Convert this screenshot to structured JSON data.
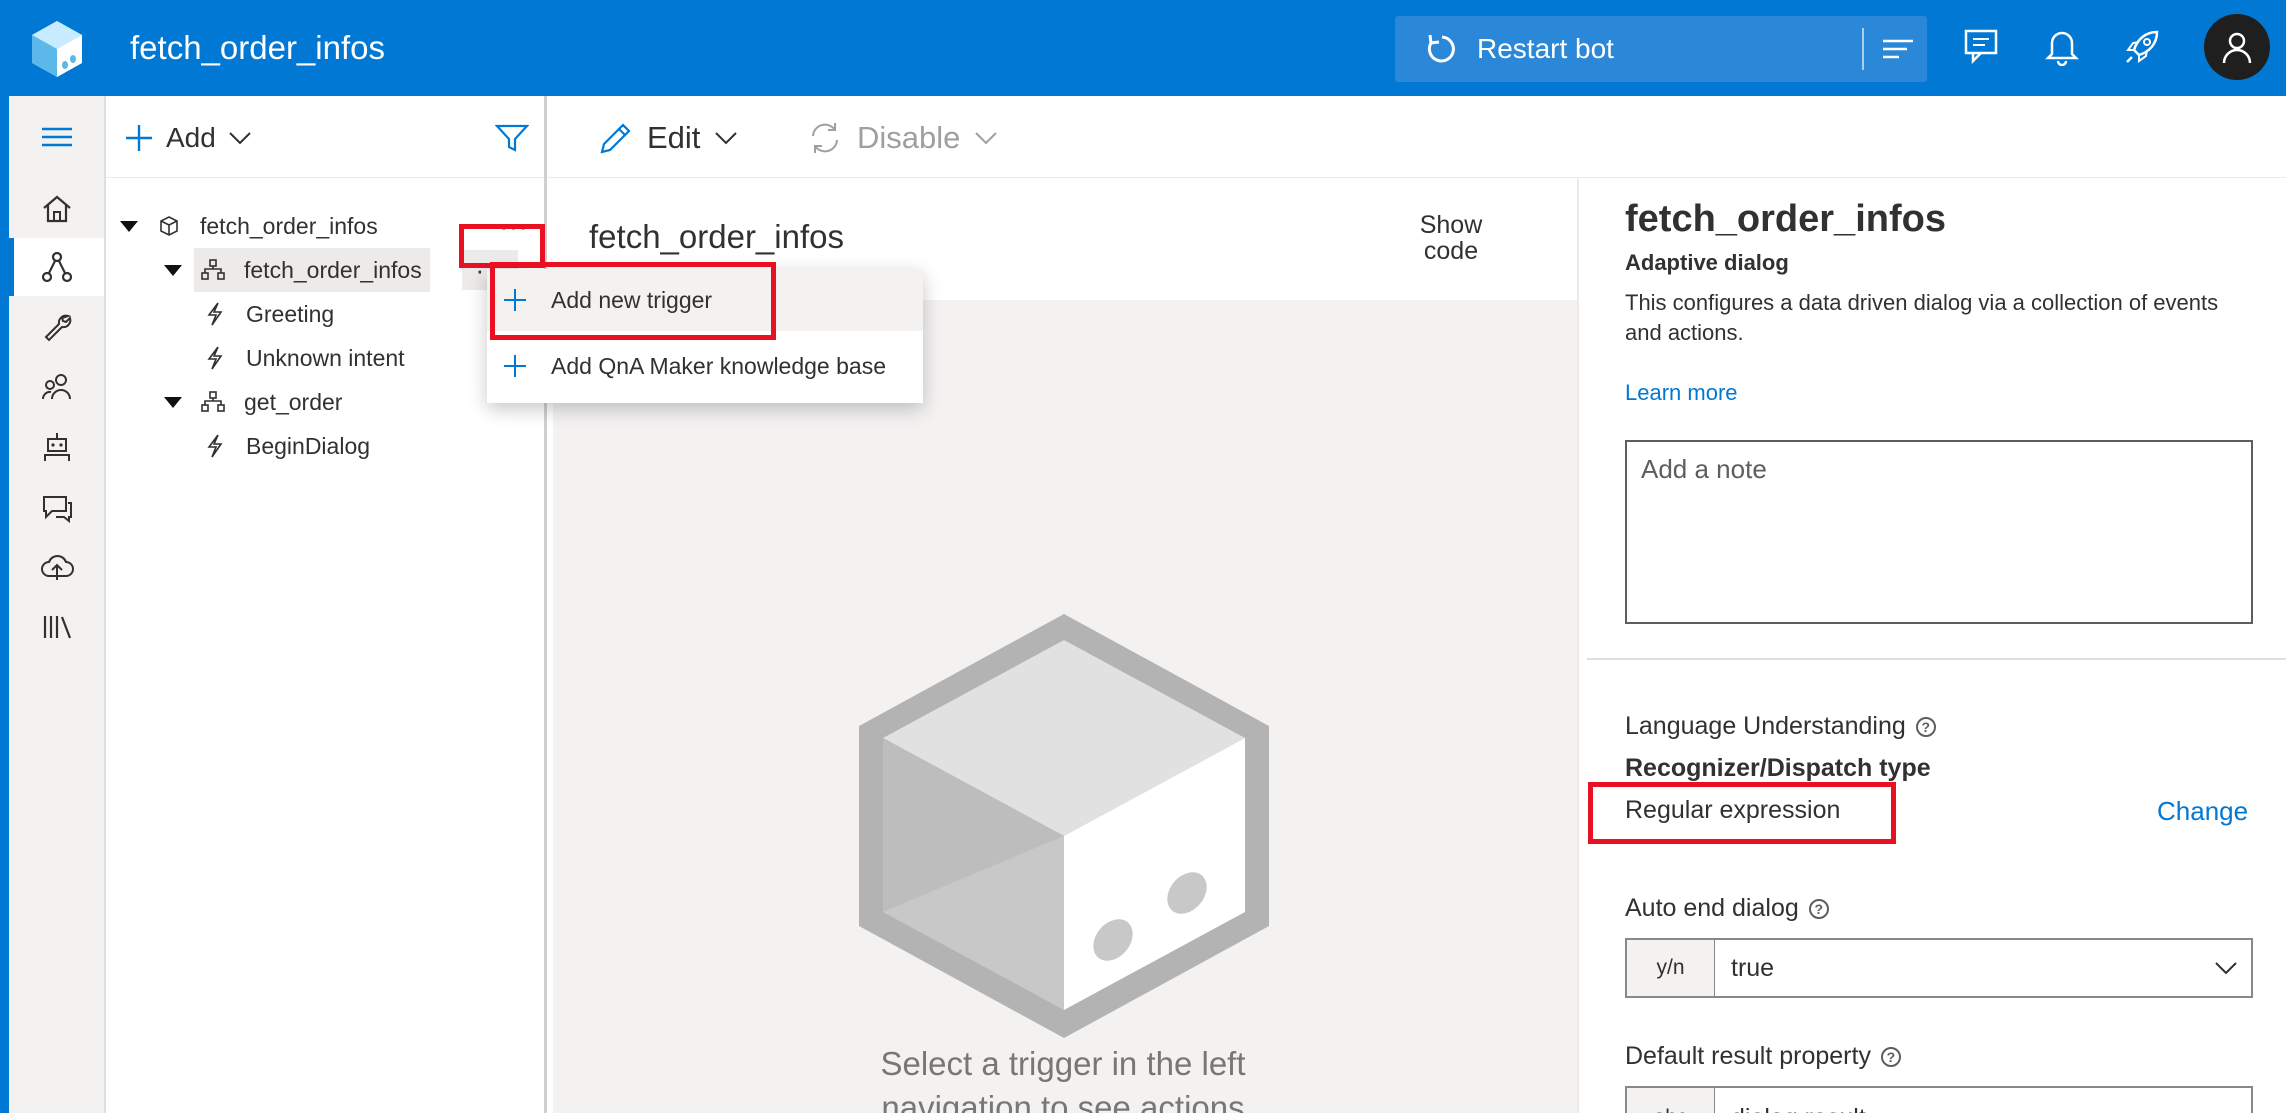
{
  "app": {
    "title": "fetch_order_infos",
    "restart_label": "Restart bot"
  },
  "tree": {
    "add_label": "Add",
    "items": [
      {
        "label": "fetch_order_infos",
        "kind": "bot"
      },
      {
        "label": "fetch_order_infos",
        "kind": "dialog"
      },
      {
        "label": "Greeting",
        "kind": "trigger"
      },
      {
        "label": "Unknown intent",
        "kind": "trigger"
      },
      {
        "label": "get_order",
        "kind": "dialog"
      },
      {
        "label": "BeginDialog",
        "kind": "trigger"
      }
    ],
    "more_label": "···"
  },
  "context_menu": {
    "items": [
      {
        "label": "Add new trigger"
      },
      {
        "label": "Add QnA Maker knowledge base"
      }
    ]
  },
  "toolbar": {
    "edit_label": "Edit",
    "disable_label": "Disable"
  },
  "canvas": {
    "title": "fetch_order_infos",
    "show_code_label": "Show code",
    "empty_message": "Select a trigger in the left navigation to see actions"
  },
  "properties": {
    "title": "fetch_order_infos",
    "subtitle": "Adaptive dialog",
    "description": "This configures a data driven dialog via a collection of events and actions.",
    "learn_more": "Learn more",
    "note_placeholder": "Add a note",
    "lu_label": "Language Understanding",
    "recognizer_label": "Recognizer/Dispatch type",
    "recognizer_value": "Regular expression",
    "change_label": "Change",
    "auto_end_label": "Auto end dialog",
    "auto_end_prefix": "y/n",
    "auto_end_value": "true",
    "default_result_label": "Default result property",
    "default_result_prefix": "abc",
    "default_result_value": "dialog.result"
  },
  "colors": {
    "brand": "#0078d4",
    "highlight_box": "#e81123"
  },
  "icons": {
    "header": [
      "composer-logo-icon",
      "restart-icon",
      "lines-menu-icon",
      "chat-icon",
      "bell-icon",
      "rocket-icon",
      "user-icon"
    ],
    "rail": [
      "hamburger-icon",
      "home-icon",
      "design-icon",
      "wrench-icon",
      "users-icon",
      "bot-icon",
      "chat-bubbles-icon",
      "cloud-upload-icon",
      "library-icon"
    ]
  }
}
